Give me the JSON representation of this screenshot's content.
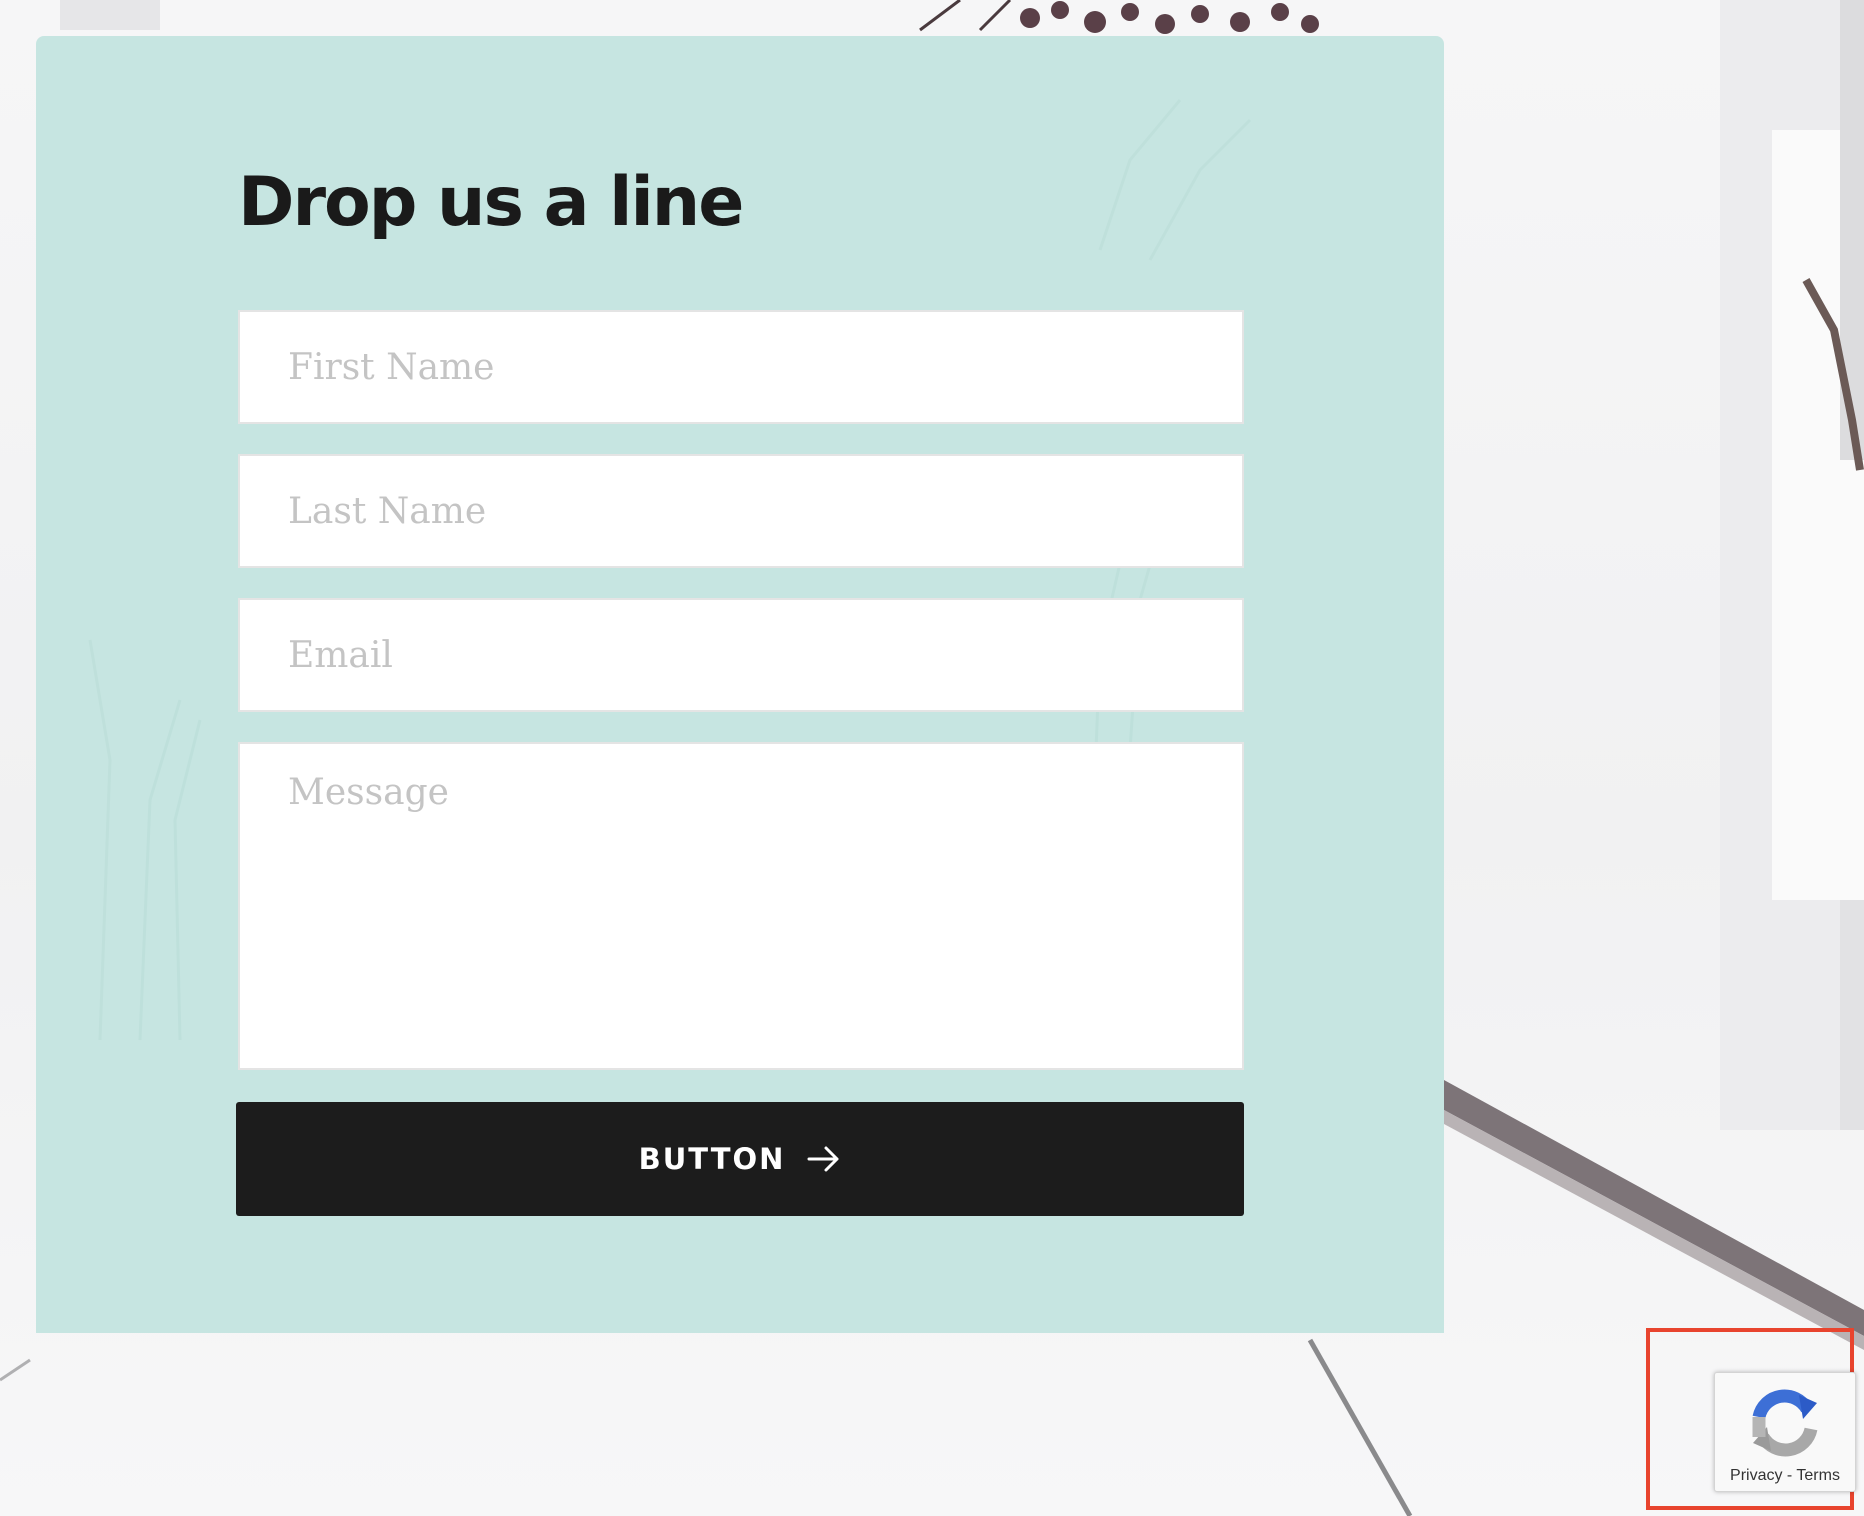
{
  "form": {
    "title": "Drop us a line",
    "first_name_placeholder": "First Name",
    "last_name_placeholder": "Last Name",
    "email_placeholder": "Email",
    "message_placeholder": "Message",
    "submit_label": "BUTTON",
    "submit_icon": "arrow-right-icon"
  },
  "recaptcha": {
    "privacy_label": "Privacy",
    "separator": " - ",
    "terms_label": "Terms",
    "icon": "recaptcha-icon"
  },
  "colors": {
    "card_background": "#c4e6e1",
    "button_background": "#1c1c1c",
    "button_text": "#ffffff",
    "highlight_border": "#e8442e"
  }
}
